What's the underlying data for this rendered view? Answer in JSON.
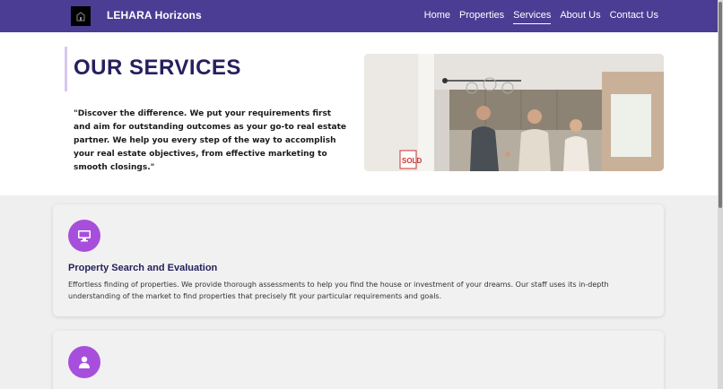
{
  "header": {
    "brand": "LEHARA Horizons",
    "nav": [
      {
        "label": "Home",
        "active": false
      },
      {
        "label": "Properties",
        "active": false
      },
      {
        "label": "Services",
        "active": true
      },
      {
        "label": "About Us",
        "active": false
      },
      {
        "label": "Contact Us",
        "active": false
      }
    ]
  },
  "hero": {
    "title": "OUR SERVICES",
    "quote": "\"Discover the difference. We put your requirements first and aim for outstanding outcomes as your go-to real estate partner. We help you every step of the way to accomplish your real estate objectives, from effective marketing to smooth closings.\"",
    "sign_text": "SOLD"
  },
  "services": [
    {
      "icon": "monitor-icon",
      "title": "Property Search and Evaluation",
      "description": "Effortless finding of properties. We provide thorough assessments to help you find the house or investment of your dreams. Our staff uses its in-depth understanding of the market to find properties that precisely fit your particular requirements and goals."
    },
    {
      "icon": "user-icon",
      "title": "",
      "description": ""
    }
  ],
  "colors": {
    "navbar": "#4b3d94",
    "title": "#25205e",
    "icon_circle": "#a74fdc"
  }
}
